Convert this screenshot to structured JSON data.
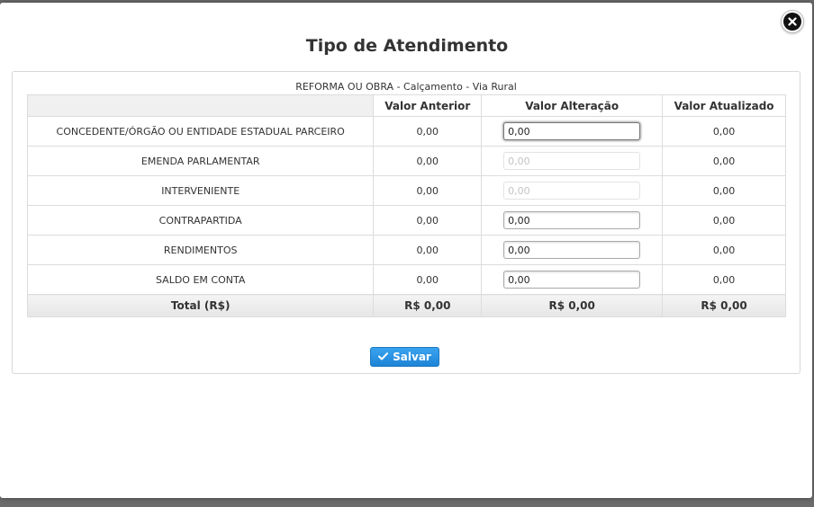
{
  "dialog": {
    "title": "Tipo de Atendimento",
    "close_icon": "close-icon"
  },
  "panel": {
    "caption": "REFORMA OU OBRA - Calçamento - Via Rural"
  },
  "table": {
    "headers": [
      "",
      "Valor Anterior",
      "Valor Alteração",
      "Valor Atualizado"
    ],
    "rows": [
      {
        "label": "CONCEDENTE/ÓRGÃO OU ENTIDADE ESTADUAL PARCEIRO",
        "anterior": "0,00",
        "alteracao": "0,00",
        "atualizado": "0,00",
        "state": "focused"
      },
      {
        "label": "EMENDA PARLAMENTAR",
        "anterior": "0,00",
        "alteracao": "0,00",
        "atualizado": "0,00",
        "state": "disabled"
      },
      {
        "label": "INTERVENIENTE",
        "anterior": "0,00",
        "alteracao": "0,00",
        "atualizado": "0,00",
        "state": "disabled"
      },
      {
        "label": "CONTRAPARTIDA",
        "anterior": "0,00",
        "alteracao": "0,00",
        "atualizado": "0,00",
        "state": "enabled"
      },
      {
        "label": "RENDIMENTOS",
        "anterior": "0,00",
        "alteracao": "0,00",
        "atualizado": "0,00",
        "state": "enabled"
      },
      {
        "label": "SALDO EM CONTA",
        "anterior": "0,00",
        "alteracao": "0,00",
        "atualizado": "0,00",
        "state": "enabled"
      }
    ],
    "total": {
      "label": "Total (R$)",
      "anterior": "R$ 0,00",
      "alteracao": "R$ 0,00",
      "atualizado": "R$ 0,00"
    }
  },
  "actions": {
    "save_label": "Salvar",
    "save_icon": "check-icon"
  },
  "colors": {
    "accent": "#2196e8",
    "title": "#333333"
  }
}
